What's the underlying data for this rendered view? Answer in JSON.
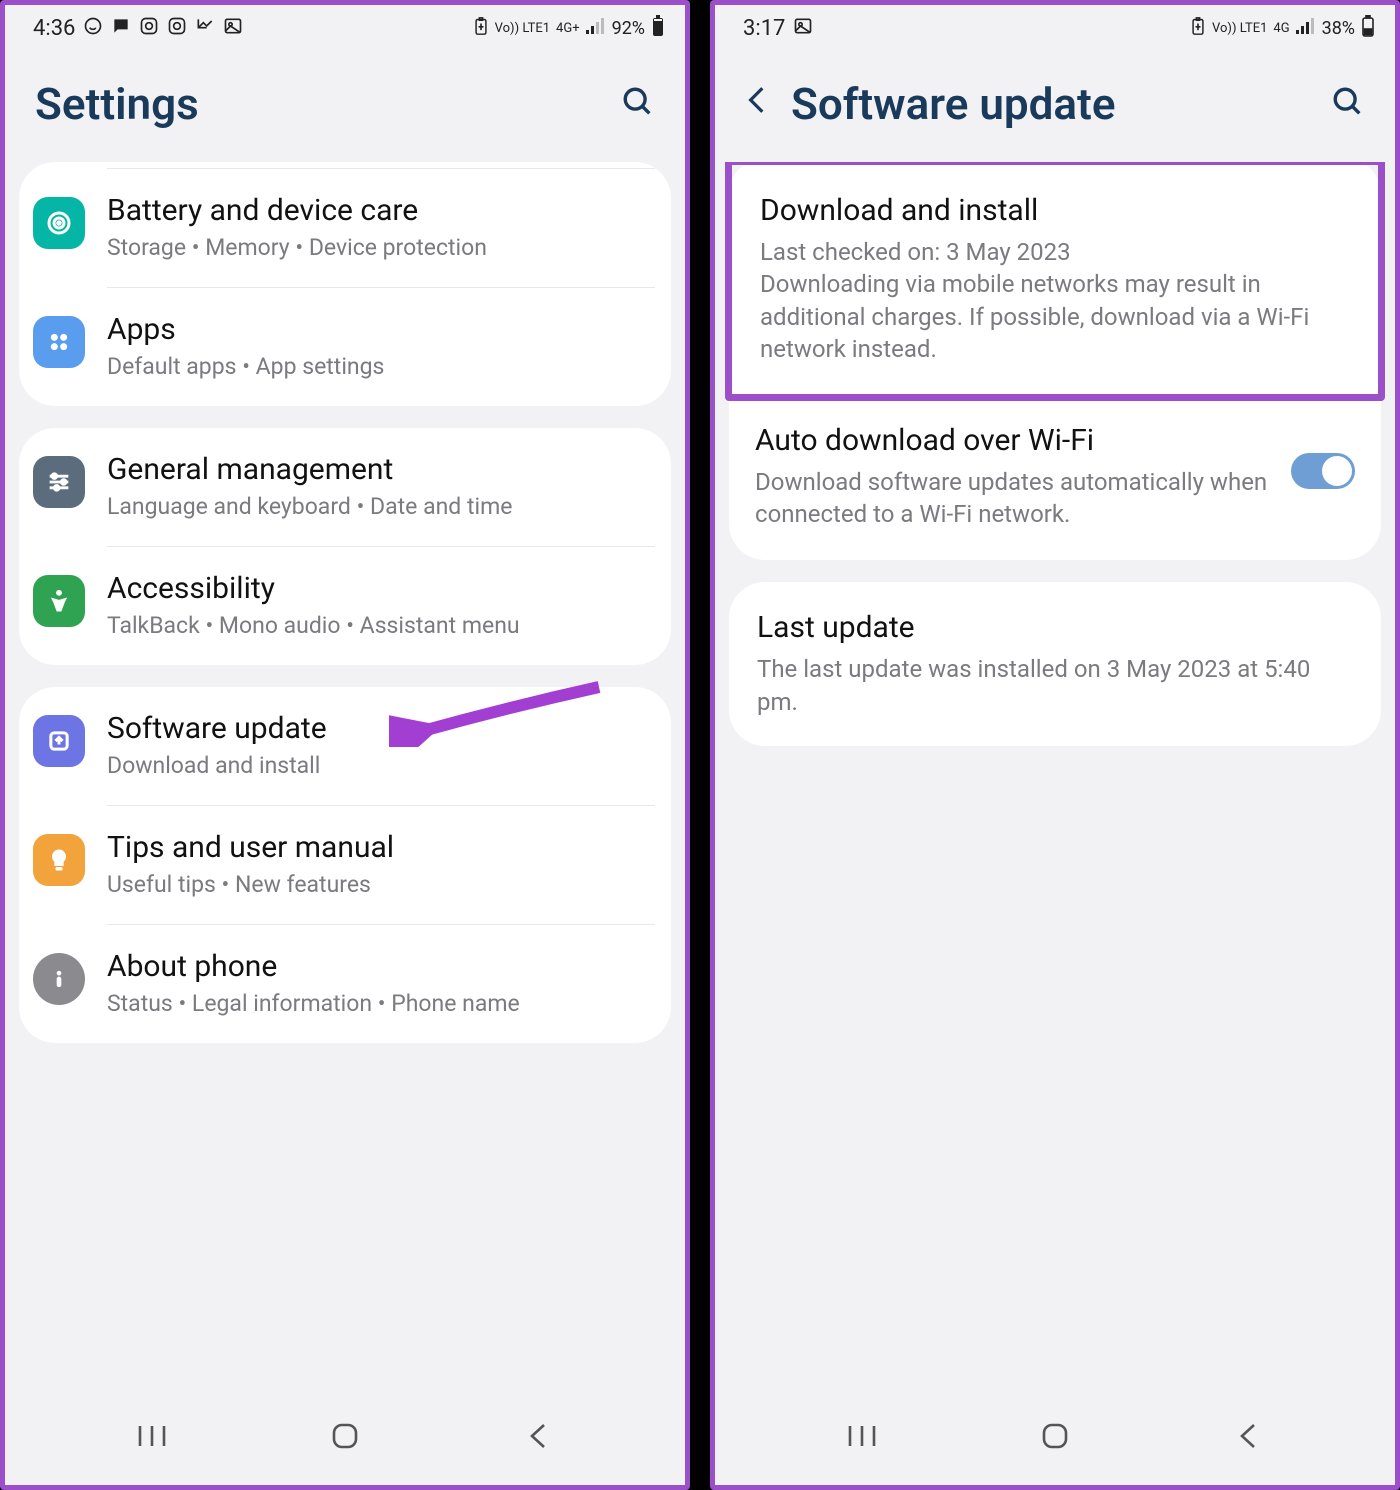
{
  "left": {
    "status": {
      "time": "4:36",
      "battery": "92%",
      "network": "4G+",
      "volte": "Vo)) LTE1"
    },
    "header": {
      "title": "Settings"
    },
    "groups": [
      {
        "items": [
          {
            "icon": "battery-care",
            "icon_bg": "#05b5a5",
            "title": "Battery and device care",
            "sub": "Storage  •  Memory  •  Device protection"
          },
          {
            "icon": "apps",
            "icon_bg": "#5a9dee",
            "title": "Apps",
            "sub": "Default apps  •  App settings"
          }
        ]
      },
      {
        "items": [
          {
            "icon": "general",
            "icon_bg": "#5b6d7d",
            "title": "General management",
            "sub": "Language and keyboard  •  Date and time"
          },
          {
            "icon": "accessibility",
            "icon_bg": "#2fa351",
            "title": "Accessibility",
            "sub": "TalkBack  •  Mono audio  •  Assistant menu"
          }
        ]
      },
      {
        "items": [
          {
            "icon": "update",
            "icon_bg": "#6d74e3",
            "title": "Software update",
            "sub": "Download and install",
            "arrow": true
          },
          {
            "icon": "tips",
            "icon_bg": "#f2a33c",
            "title": "Tips and user manual",
            "sub": "Useful tips  •  New features"
          },
          {
            "icon": "about",
            "icon_bg": "#8a8a8f",
            "title": "About phone",
            "sub": "Status  •  Legal information  •  Phone name"
          }
        ]
      }
    ]
  },
  "right": {
    "status": {
      "time": "3:17",
      "battery": "38%",
      "network": "4G",
      "volte": "Vo)) LTE1"
    },
    "header": {
      "title": "Software update"
    },
    "download": {
      "title": "Download and install",
      "checked": "Last checked on: 3 May 2023",
      "note": "Downloading via mobile networks may result in additional charges. If possible, download via a Wi-Fi network instead."
    },
    "auto": {
      "title": "Auto download over Wi-Fi",
      "sub": "Download software updates automatically when connected to a Wi-Fi network.",
      "enabled": true
    },
    "last": {
      "title": "Last update",
      "sub": "The last update was installed on 3 May 2023 at 5:40 pm."
    }
  }
}
